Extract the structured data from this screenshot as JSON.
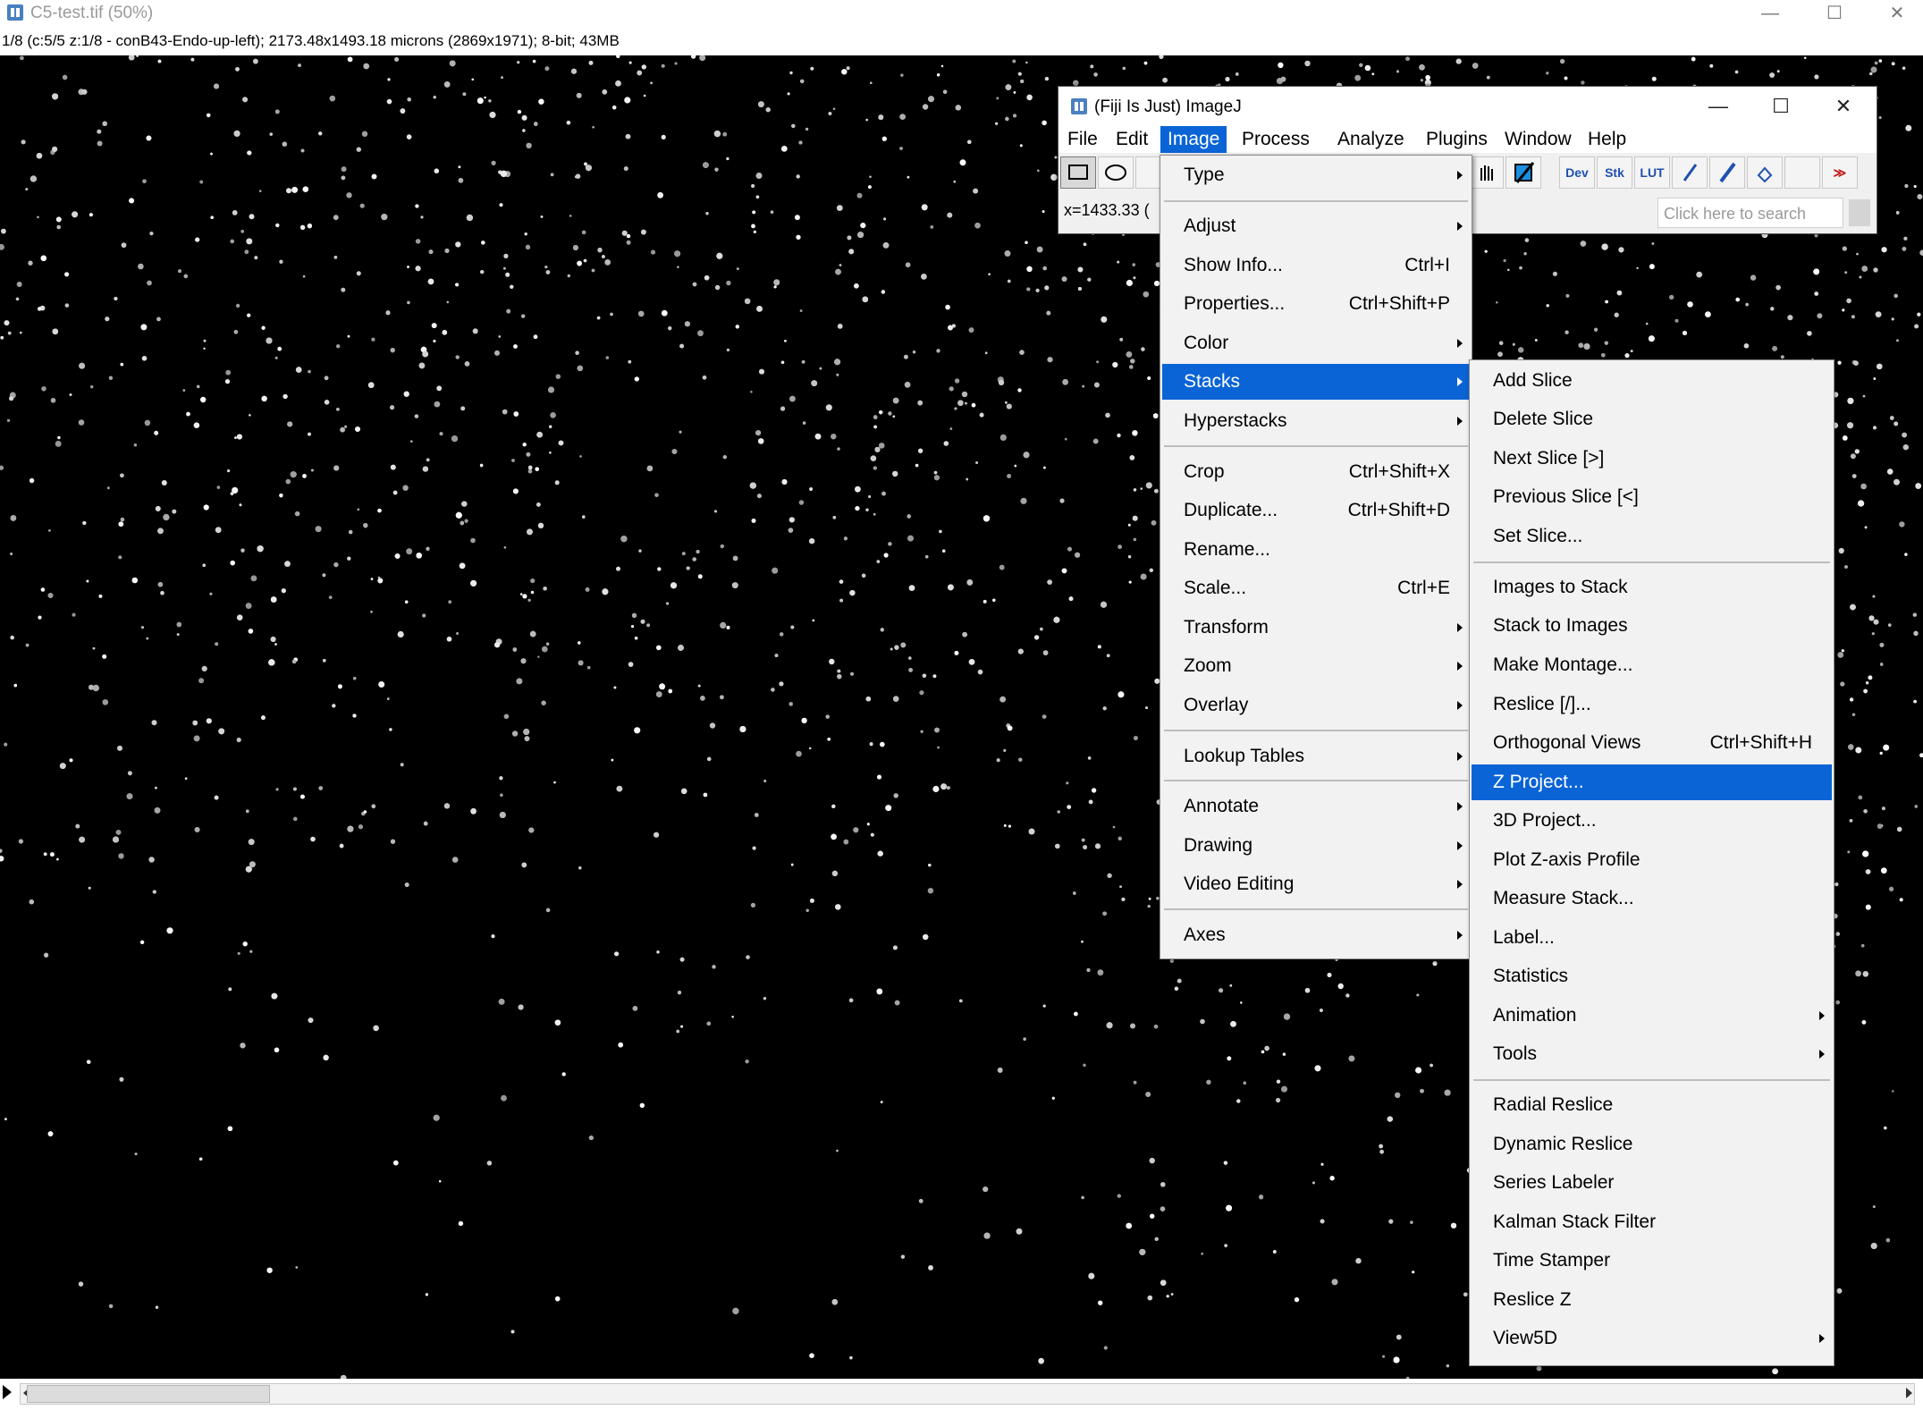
{
  "image_window": {
    "title": "C5-test.tif (50%)",
    "info": "1/8 (c:5/5 z:1/8 - conB43-Endo-up-left); 2173.48x1493.18 microns (2869x1971); 8-bit; 43MB",
    "controls": {
      "minimize": "—",
      "maximize": "☐",
      "close": "✕"
    }
  },
  "fiji": {
    "title": "(Fiji Is Just) ImageJ",
    "controls": {
      "minimize": "—",
      "maximize": "☐",
      "close": "✕"
    },
    "menus": [
      "File",
      "Edit",
      "Image",
      "Process",
      "Analyze",
      "Plugins",
      "Window",
      "Help"
    ],
    "active_menu": "Image",
    "toolbar": {
      "dev": "Dev",
      "stk": "Stk",
      "lut": "LUT",
      "more": "≫"
    },
    "status_coord": "x=1433.33 (",
    "search_placeholder": "Click here to search"
  },
  "image_menu": {
    "items": [
      {
        "label": "Type",
        "shortcut": "",
        "submenu": true
      },
      {
        "label": "Adjust",
        "shortcut": "",
        "submenu": true
      },
      {
        "label": "Show Info...",
        "shortcut": "Ctrl+I",
        "submenu": false
      },
      {
        "label": "Properties...",
        "shortcut": "Ctrl+Shift+P",
        "submenu": false
      },
      {
        "label": "Color",
        "shortcut": "",
        "submenu": true
      },
      {
        "label": "Stacks",
        "shortcut": "",
        "submenu": true,
        "highlighted": true
      },
      {
        "label": "Hyperstacks",
        "shortcut": "",
        "submenu": true
      },
      {
        "label": "Crop",
        "shortcut": "Ctrl+Shift+X",
        "submenu": false
      },
      {
        "label": "Duplicate...",
        "shortcut": "Ctrl+Shift+D",
        "submenu": false
      },
      {
        "label": "Rename...",
        "shortcut": "",
        "submenu": false
      },
      {
        "label": "Scale...",
        "shortcut": "Ctrl+E",
        "submenu": false
      },
      {
        "label": "Transform",
        "shortcut": "",
        "submenu": true
      },
      {
        "label": "Zoom",
        "shortcut": "",
        "submenu": true
      },
      {
        "label": "Overlay",
        "shortcut": "",
        "submenu": true
      },
      {
        "label": "Lookup Tables",
        "shortcut": "",
        "submenu": true
      },
      {
        "label": "Annotate",
        "shortcut": "",
        "submenu": true
      },
      {
        "label": "Drawing",
        "shortcut": "",
        "submenu": true
      },
      {
        "label": "Video Editing",
        "shortcut": "",
        "submenu": true
      },
      {
        "label": "Axes",
        "shortcut": "",
        "submenu": true
      }
    ]
  },
  "stacks_menu": {
    "items": [
      {
        "label": "Add Slice",
        "shortcut": "",
        "submenu": false
      },
      {
        "label": "Delete Slice",
        "shortcut": "",
        "submenu": false
      },
      {
        "label": "Next Slice [>]",
        "shortcut": "",
        "submenu": false
      },
      {
        "label": "Previous Slice [<]",
        "shortcut": "",
        "submenu": false
      },
      {
        "label": "Set Slice...",
        "shortcut": "",
        "submenu": false
      },
      {
        "label": "Images to Stack",
        "shortcut": "",
        "submenu": false
      },
      {
        "label": "Stack to Images",
        "shortcut": "",
        "submenu": false
      },
      {
        "label": "Make Montage...",
        "shortcut": "",
        "submenu": false
      },
      {
        "label": "Reslice [/]...",
        "shortcut": "",
        "submenu": false
      },
      {
        "label": "Orthogonal Views",
        "shortcut": "Ctrl+Shift+H",
        "submenu": false
      },
      {
        "label": "Z Project...",
        "shortcut": "",
        "submenu": false,
        "highlighted": true
      },
      {
        "label": "3D Project...",
        "shortcut": "",
        "submenu": false
      },
      {
        "label": "Plot Z-axis Profile",
        "shortcut": "",
        "submenu": false
      },
      {
        "label": "Measure Stack...",
        "shortcut": "",
        "submenu": false
      },
      {
        "label": "Label...",
        "shortcut": "",
        "submenu": false
      },
      {
        "label": "Statistics",
        "shortcut": "",
        "submenu": false
      },
      {
        "label": "Animation",
        "shortcut": "",
        "submenu": true
      },
      {
        "label": "Tools",
        "shortcut": "",
        "submenu": true
      },
      {
        "label": "Radial Reslice",
        "shortcut": "",
        "submenu": false
      },
      {
        "label": "Dynamic Reslice",
        "shortcut": "",
        "submenu": false
      },
      {
        "label": "Series Labeler",
        "shortcut": "",
        "submenu": false
      },
      {
        "label": "Kalman Stack Filter",
        "shortcut": "",
        "submenu": false
      },
      {
        "label": "Time Stamper",
        "shortcut": "",
        "submenu": false
      },
      {
        "label": "Reslice Z",
        "shortcut": "",
        "submenu": false
      },
      {
        "label": "View5D",
        "shortcut": "",
        "submenu": true
      }
    ]
  },
  "colors": {
    "highlight": "#0a64d6",
    "canvas": "#000000"
  }
}
